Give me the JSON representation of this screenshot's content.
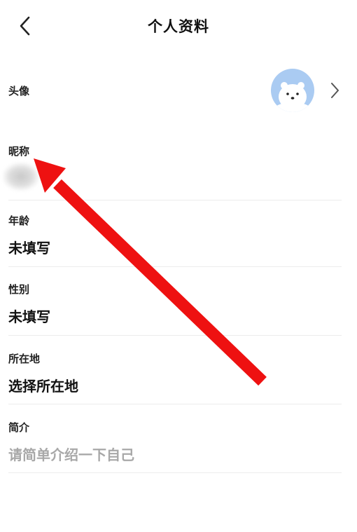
{
  "header": {
    "title": "个人资料"
  },
  "profile": {
    "avatar_label": "头像",
    "nickname_label": "昵称",
    "age_label": "年龄",
    "age_value": "未填写",
    "gender_label": "性别",
    "gender_value": "未填写",
    "location_label": "所在地",
    "location_value": "选择所在地",
    "bio_label": "简介",
    "bio_placeholder": "请简单介绍一下自己"
  },
  "icons": {
    "back": "chevron-left-icon",
    "avatar": "polar-bear-avatar",
    "disclosure": "chevron-right-icon",
    "annotation": "red-arrow"
  },
  "colors": {
    "annotation_arrow": "#ee1111",
    "avatar_bg": "#aacbf2",
    "placeholder_text": "#a8a8a8",
    "divider": "#ececec"
  }
}
